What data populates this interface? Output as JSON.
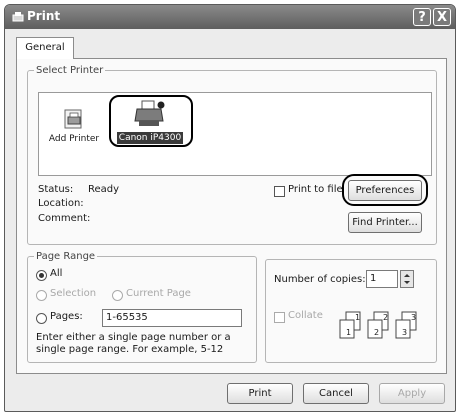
{
  "window": {
    "title": "Print",
    "help_glyph": "?",
    "close_glyph": "X"
  },
  "tab": {
    "label": "General"
  },
  "select_printer": {
    "legend": "Select Printer",
    "printers": [
      {
        "label": "Add Printer",
        "icon": "add-printer-icon",
        "selected": false
      },
      {
        "label": "Canon iP4300",
        "icon": "printer-icon",
        "selected": true
      }
    ],
    "status_label": "Status:",
    "status_value": "Ready",
    "location_label": "Location:",
    "comment_label": "Comment:",
    "print_to_file_label": "Print to file",
    "preferences_button": "Preferences",
    "find_printer_button": "Find Printer..."
  },
  "page_range": {
    "legend": "Page Range",
    "all_label": "All",
    "selection_label": "Selection",
    "current_page_label": "Current Page",
    "pages_label": "Pages:",
    "pages_value": "1-65535",
    "hint": "Enter either a single page number or a single page range.  For example, 5-12",
    "selected": "all"
  },
  "copies": {
    "label": "Number of copies:",
    "value": "1",
    "collate_label": "Collate",
    "collate_icon": "collate-pages-icon"
  },
  "footer": {
    "print_button": "Print",
    "cancel_button": "Cancel",
    "apply_button": "Apply"
  },
  "colors": {
    "titlebar": "#6f6f6f",
    "dialog": "#ececec",
    "panel": "#fafafa"
  }
}
